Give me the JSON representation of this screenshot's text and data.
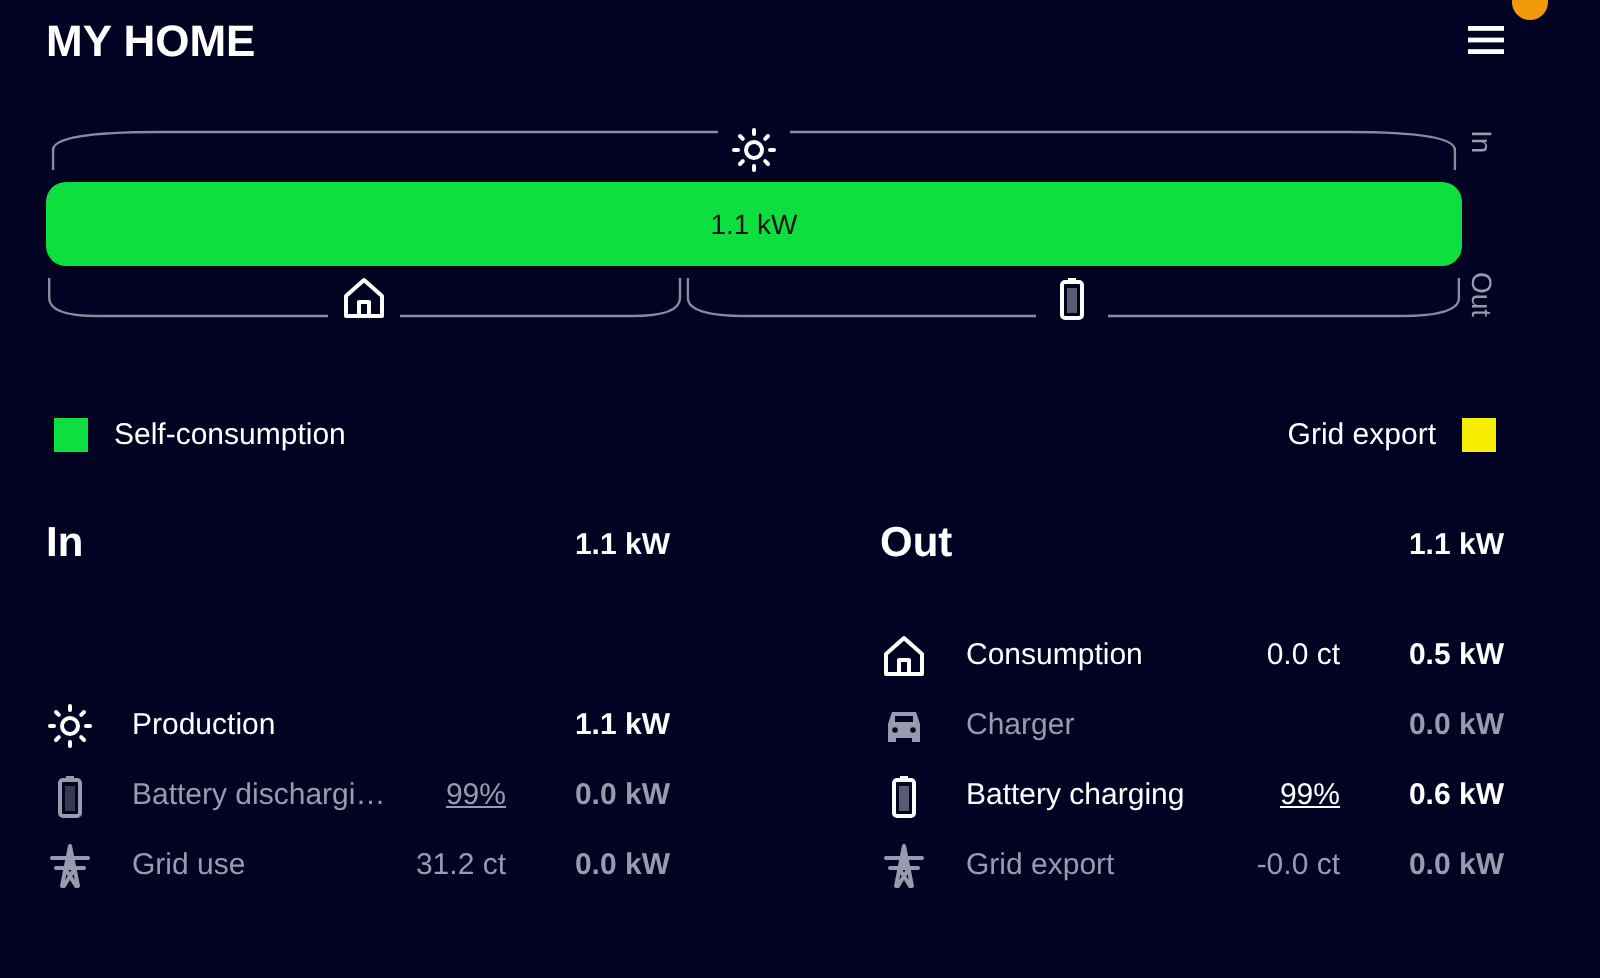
{
  "header": {
    "title": "MY HOME",
    "notification": true
  },
  "flow": {
    "in_label": "In",
    "out_label": "Out",
    "bar": {
      "label": "1.1 kW",
      "color": "#0ddf41"
    }
  },
  "legend": [
    {
      "label": "Self-consumption",
      "color": "#0ddf41"
    },
    {
      "label": "Grid export",
      "color": "#f5ee00"
    }
  ],
  "sections": [
    {
      "title": "In",
      "total": "1.1 kW",
      "rows": [
        {
          "label": "Production",
          "active": true,
          "value": "1.1 kW"
        },
        {
          "label": "Battery dischargi…",
          "active": false,
          "battery_level": "99%",
          "value": "0.0 kW"
        },
        {
          "label": "Grid use",
          "active": false,
          "price": "31.2 ct",
          "value": "0.0 kW"
        }
      ]
    },
    {
      "title": "Out",
      "total": "1.1 kW",
      "rows": [
        {
          "label": "Consumption",
          "active": true,
          "price": "0.0 ct",
          "value": "0.5 kW"
        },
        {
          "label": "Charger",
          "active": false,
          "value": "0.0 kW"
        },
        {
          "label": "Battery charging",
          "active": true,
          "battery_level": "99%",
          "value": "0.6 kW"
        },
        {
          "label": "Grid export",
          "active": false,
          "price": "-0.0 ct",
          "value": "0.0 kW"
        }
      ]
    }
  ]
}
